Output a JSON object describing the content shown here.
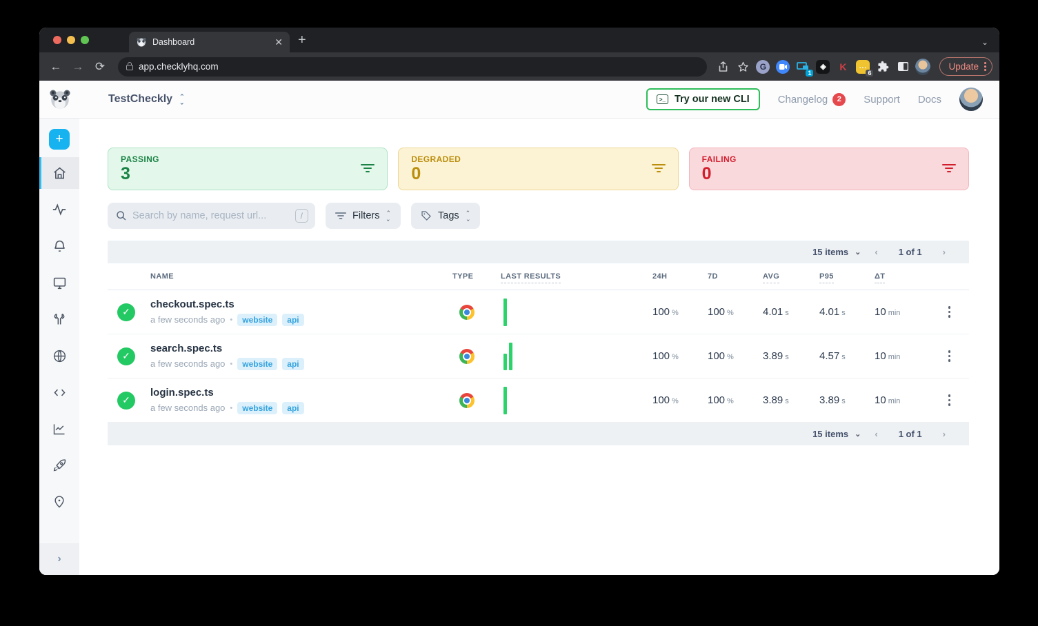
{
  "browser": {
    "tab_title": "Dashboard",
    "close_glyph": "✕",
    "new_tab_glyph": "+",
    "tab_search_glyph": "⌄",
    "back_glyph": "←",
    "forward_glyph": "→",
    "reload_glyph": "⟳",
    "url": "app.checklyhq.com",
    "extensions": {
      "grammarly_letter": "G",
      "cast_badge": "1",
      "kagi_letter": "K",
      "notes_glyph": "...",
      "notes_badge": "6",
      "stack_glyph": "◈",
      "puzzle_glyph": "⚩"
    },
    "update_label": "Update"
  },
  "header": {
    "account_name": "TestCheckly",
    "cli_button_label": "Try our new CLI",
    "cli_icon_glyph": ">_",
    "changelog_label": "Changelog",
    "changelog_badge": "2",
    "support_label": "Support",
    "docs_label": "Docs"
  },
  "cards": [
    {
      "label": "PASSING",
      "value": "3"
    },
    {
      "label": "DEGRADED",
      "value": "0"
    },
    {
      "label": "FAILING",
      "value": "0"
    }
  ],
  "filter_bar": {
    "search_placeholder": "Search by name, request url...",
    "shortcut_hint": "/",
    "filters_label": "Filters",
    "tags_label": "Tags"
  },
  "pagination": {
    "items_label": "15 items",
    "page_label": "1 of 1",
    "prev_glyph": "‹",
    "next_glyph": "›",
    "caret_glyph": "⌄"
  },
  "table": {
    "headers": {
      "name": "NAME",
      "type": "TYPE",
      "last_results": "LAST RESULTS",
      "h24": "24H",
      "d7": "7D",
      "avg": "AVG",
      "p95": "P95",
      "dt": "ΔT"
    },
    "units": {
      "percent": "%",
      "seconds": "s",
      "minutes": "min"
    },
    "check_glyph": "✓",
    "rows": [
      {
        "name": "checkout.spec.ts",
        "time": "a few seconds ago",
        "tags": {
          "t0": "website",
          "t1": "api"
        },
        "bars": [
          100
        ],
        "h24": "100",
        "d7": "100",
        "avg": "4.01",
        "p95": "4.01",
        "dt": "10"
      },
      {
        "name": "search.spec.ts",
        "time": "a few seconds ago",
        "tags": {
          "t0": "website",
          "t1": "api"
        },
        "bars": [
          60,
          100
        ],
        "h24": "100",
        "d7": "100",
        "avg": "3.89",
        "p95": "4.57",
        "dt": "10"
      },
      {
        "name": "login.spec.ts",
        "time": "a few seconds ago",
        "tags": {
          "t0": "website",
          "t1": "api"
        },
        "bars": [
          100
        ],
        "h24": "100",
        "d7": "100",
        "avg": "3.89",
        "p95": "3.89",
        "dt": "10"
      }
    ]
  },
  "colors": {
    "passing": "#1b8345",
    "degraded": "#bb8e0d",
    "failing": "#d21f2e",
    "result_bar": "#2bd36a",
    "accent_blue": "#16b3f0",
    "cli_green": "#2ebd59",
    "update_red": "#f28b82"
  }
}
